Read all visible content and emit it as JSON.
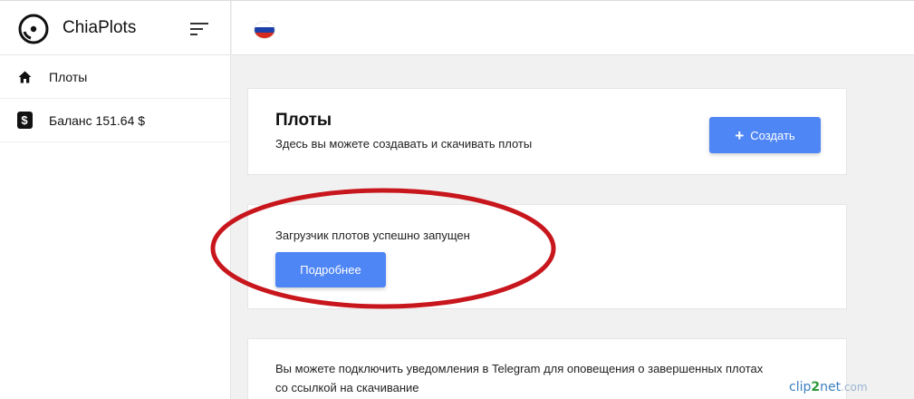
{
  "app": {
    "name": "ChiaPlots"
  },
  "sidebar": {
    "items": [
      {
        "label": "Плоты",
        "icon": "home-icon"
      },
      {
        "label": "Баланс 151.64 $",
        "icon": "dollar-icon"
      }
    ]
  },
  "header": {
    "language_flag": "russia-flag-icon"
  },
  "plots_card": {
    "title": "Плоты",
    "subtitle": "Здесь вы можете создавать и скачивать плоты",
    "create_button": {
      "icon": "+",
      "label": "Создать"
    }
  },
  "status_card": {
    "message": "Загрузчик плотов успешно запущен",
    "details_button": "Подробнее"
  },
  "telegram_card": {
    "line1": "Вы можете подключить уведомления в Telegram для оповещения о завершенных плотах",
    "line2": "со ссылкой на скачивание"
  },
  "watermark": {
    "part1": "clip",
    "part2": "2",
    "part3": "net",
    "part4": ".com"
  },
  "colors": {
    "accent": "#4f86f5",
    "annotation": "#c8161d",
    "background": "#f1f1f1"
  }
}
